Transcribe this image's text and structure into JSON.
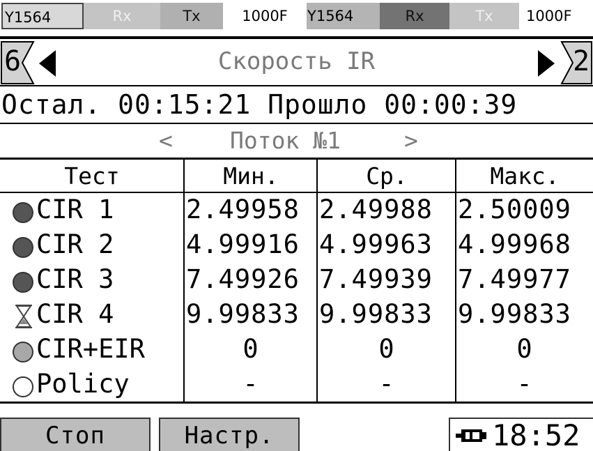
{
  "status_bar": {
    "port1_id": "Y1564",
    "port1_rx": "Rx",
    "port1_tx": "Tx",
    "port1_mode": "1000F",
    "port2_id": "Y1564",
    "port2_rx": "Rx",
    "port2_tx": "Tx",
    "port2_mode": "1000F"
  },
  "nav": {
    "prev_page": "6",
    "title": "Скорость IR",
    "next_page": "2"
  },
  "timer": {
    "remaining_label": "Остал.",
    "remaining_value": "00:15:21",
    "elapsed_label": "Прошло",
    "elapsed_value": "00:00:39"
  },
  "stream": {
    "prev_arrow": "<",
    "label": "Поток №1",
    "next_arrow": ">"
  },
  "table": {
    "headers": [
      "Тест",
      "Мин.",
      "Ср.",
      "Макс."
    ],
    "rows": [
      {
        "status_icon": "filled-dark-circle-icon",
        "test": "CIR 1",
        "min": "2.49958",
        "avg": "2.49988",
        "max": "2.50009"
      },
      {
        "status_icon": "filled-dark-circle-icon",
        "test": "CIR 2",
        "min": "4.99916",
        "avg": "4.99963",
        "max": "4.99968"
      },
      {
        "status_icon": "filled-dark-circle-icon",
        "test": "CIR 3",
        "min": "7.49926",
        "avg": "7.49939",
        "max": "7.49977"
      },
      {
        "status_icon": "hourglass-icon",
        "test": "CIR 4",
        "min": "9.99833",
        "avg": "9.99833",
        "max": "9.99833"
      },
      {
        "status_icon": "filled-gray-circle-icon",
        "test": "CIR+EIR",
        "min": "0",
        "avg": "0",
        "max": "0"
      },
      {
        "status_icon": "empty-circle-icon",
        "test": "Policy",
        "min": "-",
        "avg": "-",
        "max": "-"
      }
    ]
  },
  "bottom_bar": {
    "stop_button": "Стоп",
    "settings_button": "Настр.",
    "clock": "18:52",
    "battery_icon": "battery-plug-icon"
  },
  "colors": {
    "dark_dot": "#555555",
    "gray_dot": "#a8a8a8",
    "button_bg": "#bdbdbd",
    "muted_text": "#7a7a7a"
  }
}
